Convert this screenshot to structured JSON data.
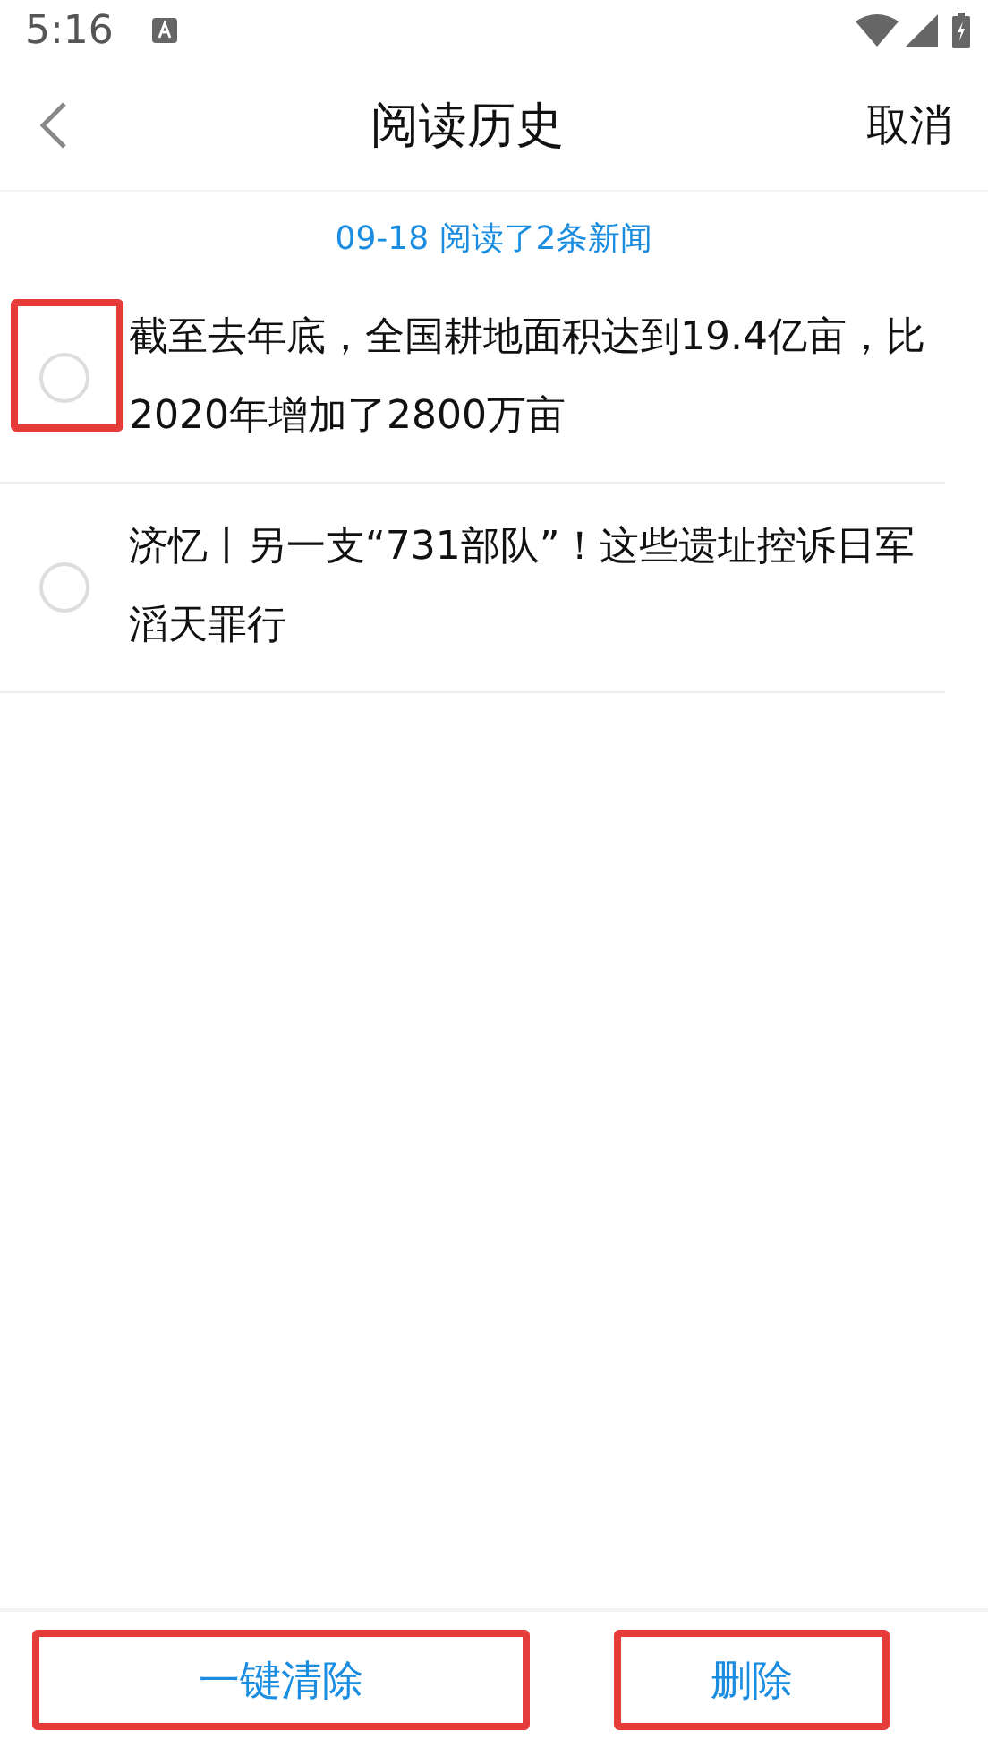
{
  "status_bar": {
    "time": "5:16"
  },
  "header": {
    "title": "阅读历史",
    "action": "取消"
  },
  "summary": "09-18 阅读了2条新闻",
  "items": [
    {
      "title": "截至去年底，全国耕地面积达到19.4亿亩，比2020年增加了2800万亩",
      "selected": false,
      "highlighted": true
    },
    {
      "title": "济忆丨另一支“731部队”！这些遗址控诉日军滔天罪行",
      "selected": false,
      "highlighted": false
    }
  ],
  "buttons": [
    {
      "label": "一键清除",
      "highlighted": true
    },
    {
      "label": "删除",
      "highlighted": true
    }
  ]
}
